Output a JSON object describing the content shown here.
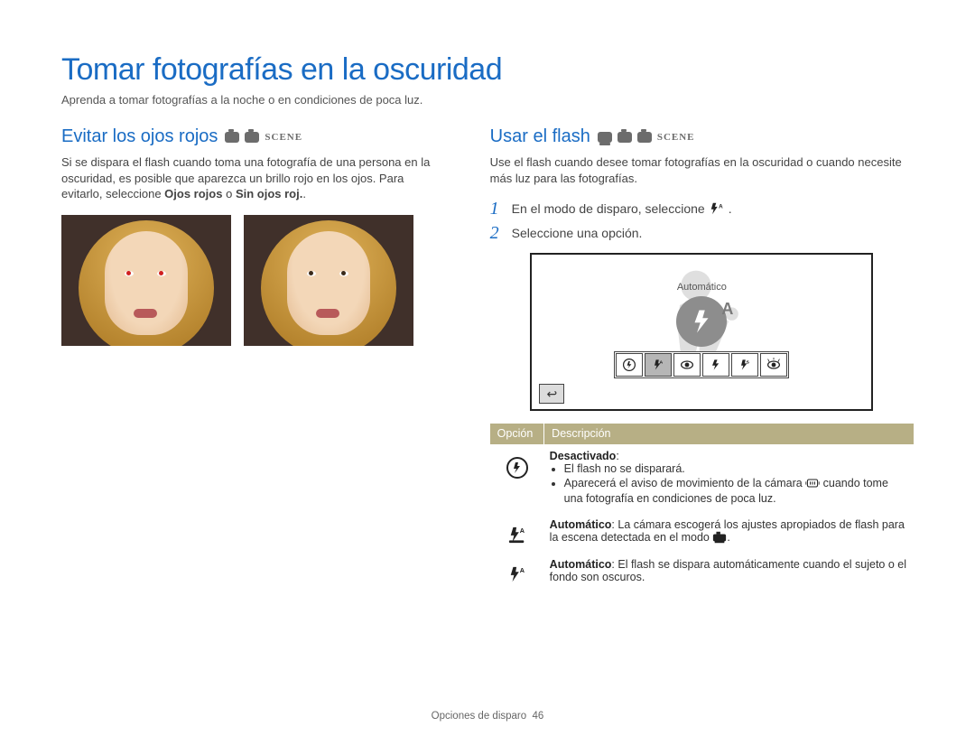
{
  "title": "Tomar fotografías en la oscuridad",
  "intro": "Aprenda a tomar fotografías a la noche o en condiciones de poca luz.",
  "left": {
    "heading": "Evitar los ojos rojos",
    "body_pre": "Si se dispara el flash cuando toma una fotografía de una persona en la oscuridad, es posible que aparezca un brillo rojo en los ojos. Para evitarlo, seleccione ",
    "body_bold1": "Ojos rojos",
    "body_mid": " o ",
    "body_bold2": "Sin ojos roj.",
    "body_post": "."
  },
  "right": {
    "heading": "Usar el flash",
    "body": "Use el flash cuando desee tomar fotografías en la oscuridad o cuando necesite más luz para las fotografías.",
    "step1": "En el modo de disparo, seleccione",
    "step1_end": ".",
    "step2": "Seleccione una opción.",
    "screen_label": "Automático"
  },
  "mode_icons": {
    "scene_label": "SCENE"
  },
  "table": {
    "h1": "Opción",
    "h2": "Descripción",
    "rows": [
      {
        "label": "Desactivado",
        "b1_pre": "",
        "b1": "El flash no se disparará.",
        "b2_pre": "Aparecerá el aviso de movimiento de la cámara ",
        "b2_post": " cuando tome una fotografía en condiciones de poca luz."
      },
      {
        "label": "Automático",
        "text_pre": ": La cámara escogerá los ajustes apropiados de flash para la escena detectada en el modo ",
        "text_post": "."
      },
      {
        "label": "Automático",
        "text": ": El flash se dispara automáticamente cuando el sujeto o el fondo son oscuros."
      }
    ]
  },
  "footer": {
    "section": "Opciones de disparo",
    "page": "46"
  }
}
